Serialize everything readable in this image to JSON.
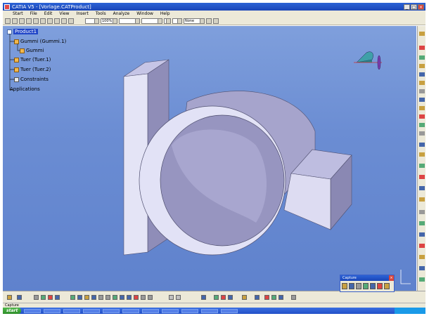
{
  "window": {
    "title": "CATIA V5 - [Vorlage.CATProduct]",
    "controls": [
      "_",
      "□",
      "×"
    ]
  },
  "menu": {
    "items": [
      "Start",
      "File",
      "Edit",
      "View",
      "Insert",
      "Tools",
      "Analyze",
      "Window",
      "Help"
    ]
  },
  "toolbar": {
    "zoom_value": "100%",
    "layer_value": "None"
  },
  "tree": {
    "root": "Product1",
    "items": [
      "Gummi (Gummi.1)",
      "Gummi",
      "Tuer (Tuer.1)",
      "Tuer (Tuer.2)",
      "Constraints",
      "Applications"
    ]
  },
  "capture_toolbar": {
    "title": "Capture"
  },
  "taskbar": {
    "start_label": "start"
  },
  "colors": {
    "viewport_bg": "#6b8dd3",
    "part_fill": "#d6d7f2",
    "part_shade": "#a9a7cc",
    "part_dark": "#8b89b3"
  }
}
